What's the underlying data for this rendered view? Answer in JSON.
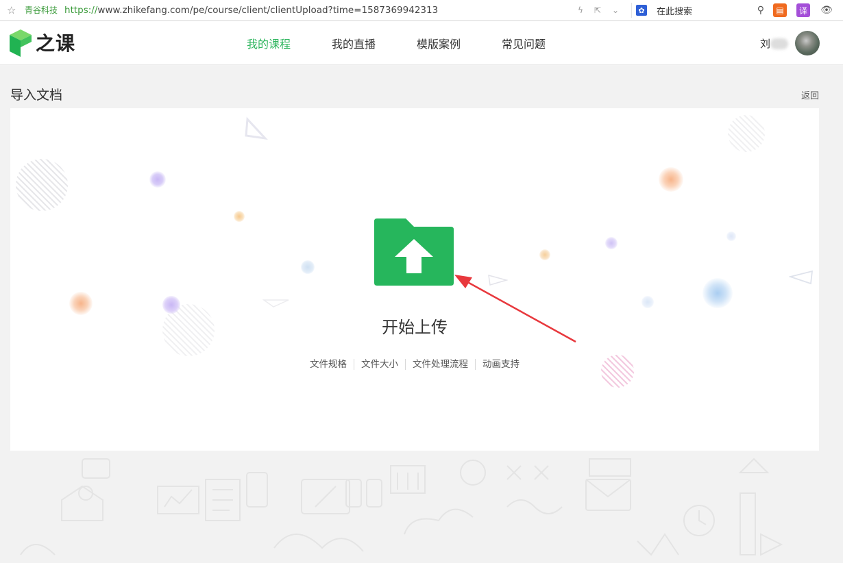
{
  "browser": {
    "site_label": "青谷科技",
    "url_scheme": "https://",
    "url_rest": "www.zhikefang.com/pe/course/client/clientUpload?time=1587369942313",
    "search_placeholder": "在此搜索",
    "ext_translate": "译"
  },
  "header": {
    "logo_text": "之课",
    "nav": [
      {
        "label": "我的课程",
        "active": true
      },
      {
        "label": "我的直播",
        "active": false
      },
      {
        "label": "模版案例",
        "active": false
      },
      {
        "label": "常见问题",
        "active": false
      }
    ],
    "user_name": "刘"
  },
  "page": {
    "title": "导入文档",
    "back": "返回"
  },
  "upload": {
    "label": "开始上传",
    "links": [
      "文件规格",
      "文件大小",
      "文件处理流程",
      "动画支持"
    ]
  },
  "colors": {
    "accent": "#2db55d",
    "annotation_arrow": "#e8383d"
  }
}
